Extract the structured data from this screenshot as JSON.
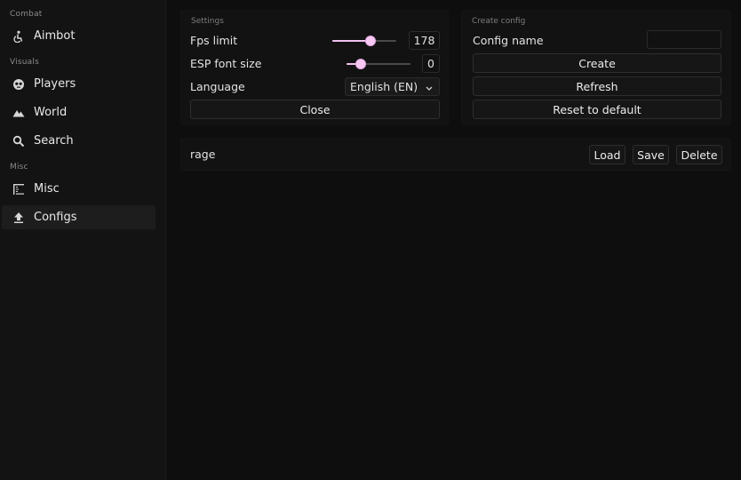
{
  "sidebar": {
    "sections": [
      {
        "label": "Combat"
      },
      {
        "label": "Visuals"
      },
      {
        "label": "Misc"
      }
    ],
    "items": [
      {
        "label": "Aimbot",
        "icon": "aimbot-icon"
      },
      {
        "label": "Players",
        "icon": "players-icon"
      },
      {
        "label": "World",
        "icon": "world-icon"
      },
      {
        "label": "Search",
        "icon": "search-icon"
      },
      {
        "label": "Misc",
        "icon": "misc-icon"
      },
      {
        "label": "Configs",
        "icon": "upload-icon",
        "active": true
      }
    ]
  },
  "settings": {
    "title": "Settings",
    "fps_label": "Fps limit",
    "fps_value": "178",
    "fps_fraction": 0.6,
    "esp_label": "ESP font size",
    "esp_value": "0",
    "esp_fraction": 0.22,
    "language_label": "Language",
    "language_value": "English (EN)",
    "close_label": "Close"
  },
  "create_config": {
    "title": "Create config",
    "name_label": "Config name",
    "name_value": "",
    "create_label": "Create",
    "refresh_label": "Refresh",
    "reset_label": "Reset to default"
  },
  "configs": {
    "rows": [
      {
        "name": "rage",
        "load_label": "Load",
        "save_label": "Save",
        "delete_label": "Delete"
      }
    ]
  },
  "colors": {
    "accent": "#f3c1f0",
    "background": "#0e0e0e",
    "sidebar": "#131313",
    "panel": "#121212"
  }
}
